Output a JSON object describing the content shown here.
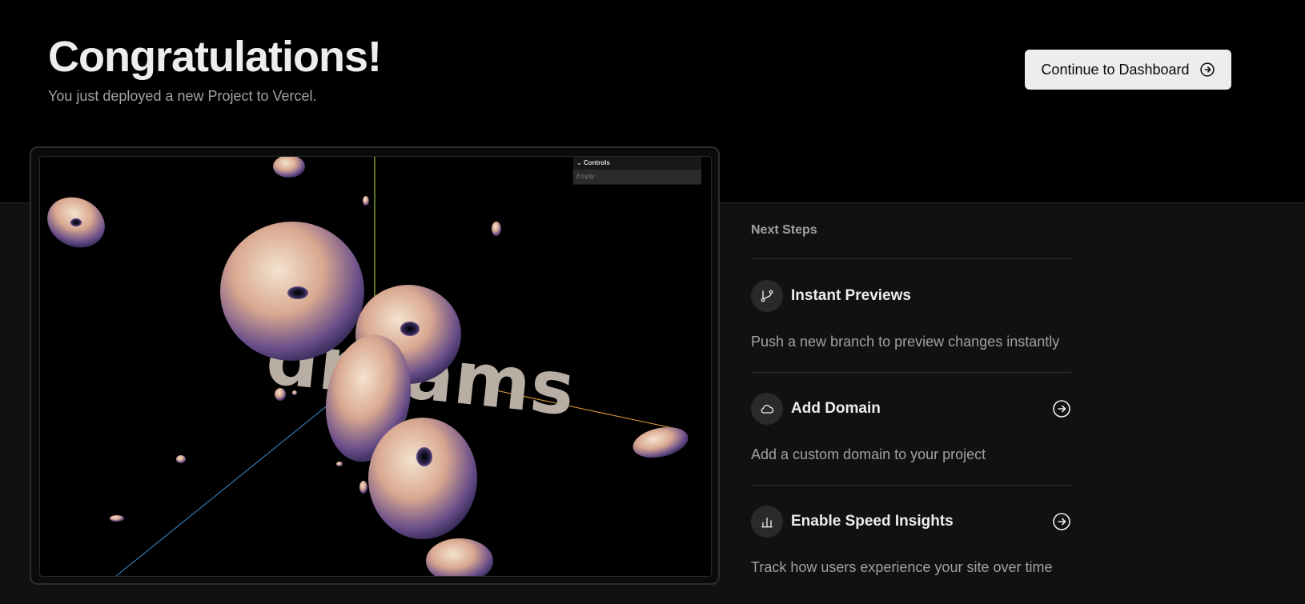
{
  "header": {
    "title": "Congratulations!",
    "subtitle": "You just deployed a new Project to Vercel."
  },
  "cta": {
    "label": "Continue to Dashboard",
    "icon": "arrow-circle-right-icon"
  },
  "preview": {
    "controls_label": "Controls",
    "controls_empty": "Empty",
    "scene_text": "dreams"
  },
  "next_steps": {
    "heading": "Next Steps",
    "items": [
      {
        "title": "Instant Previews",
        "description": "Push a new branch to preview changes instantly",
        "icon": "git-branch-icon"
      },
      {
        "title": "Add Domain",
        "description": "Add a custom domain to your project",
        "icon": "cloud-icon"
      },
      {
        "title": "Enable Speed Insights",
        "description": "Track how users experience your site over time",
        "icon": "bar-chart-icon"
      }
    ]
  },
  "colors": {
    "background_top": "#000000",
    "background_bottom": "#111111",
    "button_bg": "#ededed",
    "text_primary": "#ededed",
    "text_secondary": "#a1a1a1"
  }
}
